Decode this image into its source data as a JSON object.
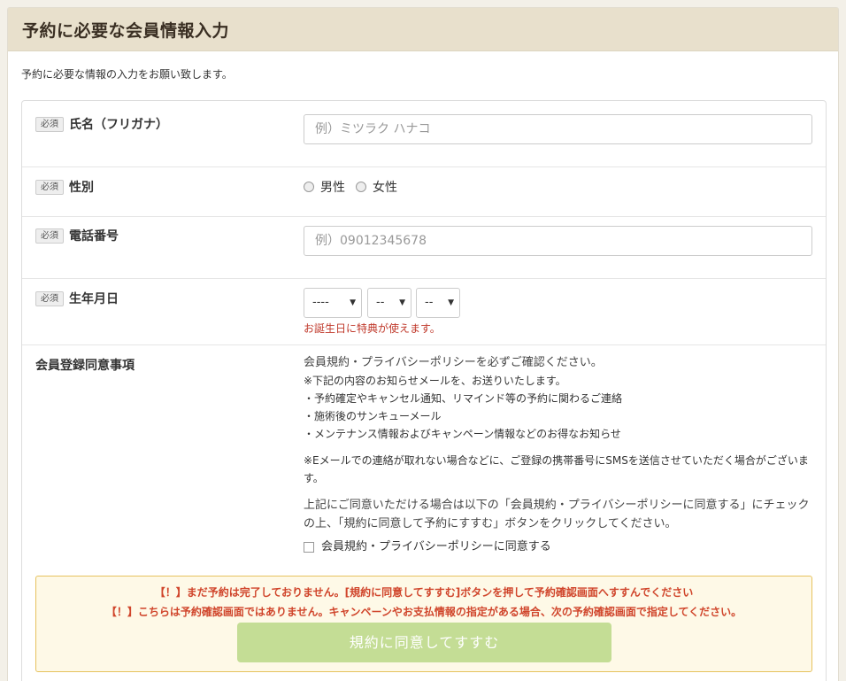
{
  "page": {
    "title": "予約に必要な会員情報入力",
    "intro": "予約に必要な情報の入力をお願い致します。"
  },
  "required_label": "必須",
  "fields": {
    "furigana": {
      "label": "氏名（フリガナ）",
      "placeholder": "例）ミツラク ハナコ"
    },
    "gender": {
      "label": "性別",
      "options": [
        "男性",
        "女性"
      ]
    },
    "phone": {
      "label": "電話番号",
      "placeholder": "例）09012345678"
    },
    "birthday": {
      "label": "生年月日",
      "year": "----",
      "month": "--",
      "day": "--",
      "note": "お誕生日に特典が使えます。"
    }
  },
  "terms": {
    "label": "会員登録同意事項",
    "lead": "会員規約・プライバシーポリシーを必ずご確認ください。",
    "line1": "※下記の内容のお知らせメールを、お送りいたします。",
    "line2": "・予約確定やキャンセル通知、リマインド等の予約に関わるご連絡",
    "line3": "・施術後のサンキューメール",
    "line4": "・メンテナンス情報およびキャンペーン情報などのお得なお知らせ",
    "sms_note": "※Eメールでの連絡が取れない場合などに、ご登録の携帯番号にSMSを送信させていただく場合がございます。",
    "agree_instruction": "上記にご同意いただける場合は以下の「会員規約・プライバシーポリシーに同意する」にチェックの上、「規約に同意して予約にすすむ」ボタンをクリックしてください。",
    "checkbox_label": "会員規約・プライバシーポリシーに同意する"
  },
  "warning": {
    "line1": "【！】まだ予約は完了しておりません。[規約に同意してすすむ]ボタンを押して予約確認画面へすすんでください",
    "line2": "【！】こちらは予約確認画面ではありません。キャンペーンやお支払情報の指定がある場合、次の予約確認画面で指定してください。",
    "button": "規約に同意してすすむ"
  }
}
